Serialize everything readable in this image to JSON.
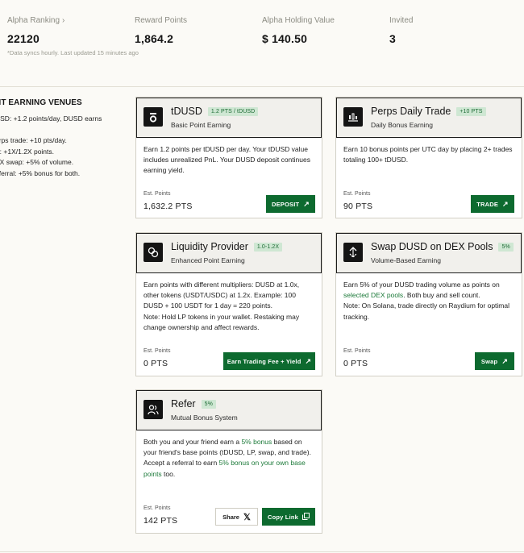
{
  "stats": {
    "ranking_label": "Alpha Ranking",
    "ranking_value": "22120",
    "points_label": "Reward Points",
    "points_value": "1,864.2",
    "holding_label": "Alpha Holding Value",
    "holding_value": "$ 140.50",
    "invited_label": "Invited",
    "invited_value": "3",
    "sync_note": "*Data syncs hourly. Last updated 15 minutes ago"
  },
  "left_panel": {
    "title": "NT EARNING VENUES",
    "lines": [
      "USD: +1.2 points/day, DUSD earns",
      ".",
      "erps trade: +10 pts/day.",
      "P: +1X/1.2X points.",
      "EX swap: +5% of volume.",
      "eferral: +5% bonus for both."
    ]
  },
  "cards": {
    "tdusd": {
      "title": "tDUSD",
      "badge": "1.2 PTS / tDUSD",
      "subtitle": "Basic Point Earning",
      "desc": "Earn 1.2 points per tDUSD per day. Your tDUSD value includes unrealized PnL. Your DUSD deposit continues earning yield.",
      "est_label": "Est. Points",
      "est_value": "1,632.2 PTS",
      "button": "DEPOSIT",
      "icon": "tdusd-logo"
    },
    "perps": {
      "title": "Perps Daily Trade",
      "badge": "+10 PTS",
      "subtitle": "Daily Bonus Earning",
      "desc": "Earn 10 bonus points per UTC day by placing 2+ trades totaling 100+ tDUSD.",
      "est_label": "Est. Points",
      "est_value": "90 PTS",
      "button": "TRADE",
      "icon": "chart-icon"
    },
    "liquidity": {
      "title": "Liquidity Provider",
      "badge": "1.0-1.2X",
      "subtitle": "Enhanced Point Earning",
      "desc": "Earn points with different multipliers: DUSD at 1.0x, other tokens (USDT/USDC) at 1.2x. Example: 100 DUSD + 100 USDT for 1 day = 220 points.",
      "note": "Note: Hold LP tokens in your wallet. Restaking may change ownership and affect rewards.",
      "est_label": "Est. Points",
      "est_value": "0 PTS",
      "button": "Earn Trading Fee + Yield",
      "icon": "coins-icon"
    },
    "swap": {
      "title": "Swap DUSD on DEX Pools",
      "badge": "5%",
      "subtitle": "Volume-Based Earning",
      "desc_a": "Earn 5% of your DUSD trading volume as points on ",
      "desc_link": "selected DEX pools",
      "desc_b": ". Both buy and sell count.",
      "note": "Note: On Solana, trade directly on Raydium for optimal tracking.",
      "est_label": "Est. Points",
      "est_value": "0 PTS",
      "button": "Swap",
      "icon": "swap-icon"
    },
    "refer": {
      "title": "Refer",
      "badge": "5%",
      "subtitle": "Mutual Bonus System",
      "desc_a": "Both you and your friend earn a ",
      "desc_link": "5% bonus",
      "desc_b": " based on your friend's base points (tDUSD, LP, swap, and trade).",
      "desc_c": "Accept a referral to earn ",
      "desc_link2": "5% bonus on your own base points",
      "desc_d": " too.",
      "est_label": "Est. Points",
      "est_value": "142 PTS",
      "share_button": "Share",
      "copy_button": "Copy Link",
      "icon": "users-icon"
    }
  },
  "colors": {
    "accent": "#0d6a2f",
    "badge_bg": "#cfe7d3"
  }
}
